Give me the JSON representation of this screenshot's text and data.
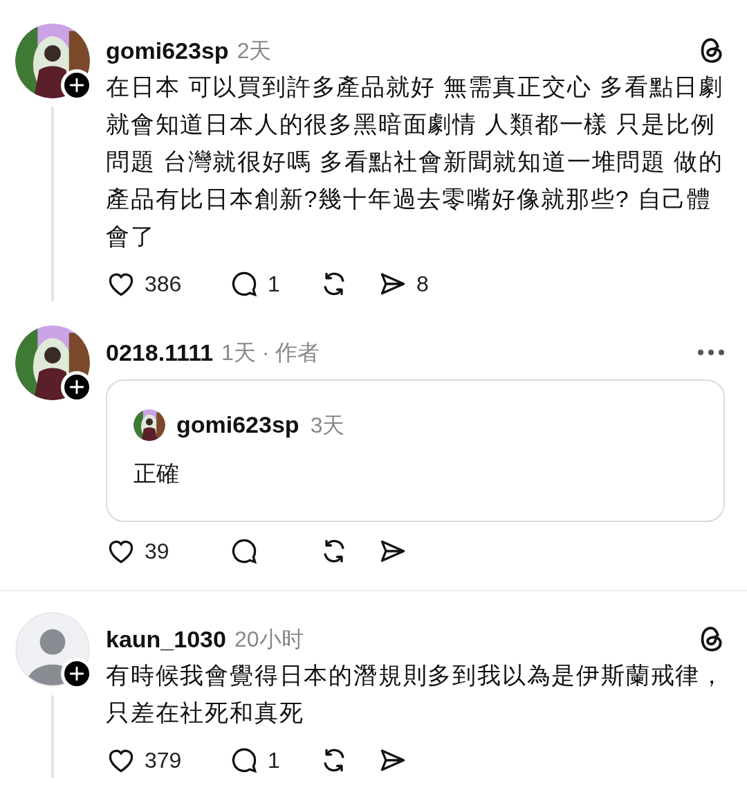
{
  "posts": [
    {
      "kind": "post",
      "username": "gomi623sp",
      "meta": "2天",
      "logo": true,
      "more": false,
      "thread_line": true,
      "text": "在日本 可以買到許多產品就好 無需真正交心 多看點日劇就會知道日本人的很多黑暗面劇情 人類都一樣 只是比例問題 台灣就很好嗎 多看點社會新聞就知道一堆問題 做的產品有比日本創新?幾十年過去零嘴好像就那些? 自己體會了",
      "likes": "386",
      "replies": "1",
      "shares": "8"
    },
    {
      "kind": "reply",
      "username": "0218.1111",
      "meta": "1天 · 作者",
      "logo": false,
      "more": true,
      "thread_line": false,
      "quote": {
        "username": "gomi623sp",
        "meta": "3天",
        "text": "正確"
      },
      "likes": "39"
    },
    {
      "kind": "post",
      "avatar": {
        "kind": "default"
      },
      "username": "kaun_1030",
      "meta": "20小时",
      "logo": true,
      "more": false,
      "thread_line": true,
      "text": "有時候我會覺得日本的潛規則多到我以為是伊斯蘭戒律，只差在社死和真死",
      "likes": "379",
      "replies": "1"
    }
  ]
}
